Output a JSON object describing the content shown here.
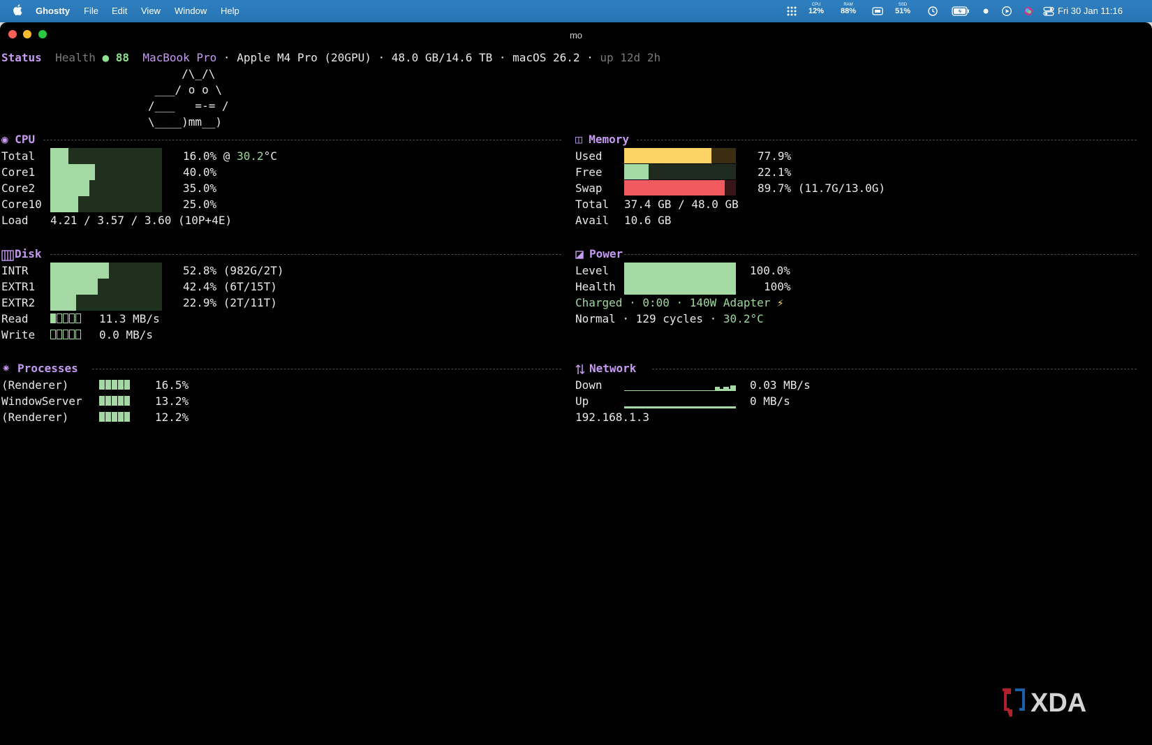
{
  "menubar": {
    "app": "Ghostty",
    "menus": [
      "File",
      "Edit",
      "View",
      "Window",
      "Help"
    ],
    "stats": [
      {
        "label": "CPU",
        "value": "12%"
      },
      {
        "label": "RAM",
        "value": "88%"
      },
      {
        "label": "SSD",
        "value": "51%"
      }
    ],
    "clock": "Fri 30 Jan 11:16"
  },
  "window": {
    "title": "mo"
  },
  "status": {
    "label": "Status",
    "health_label": "Health",
    "health_value": "88",
    "model": "MacBook Pro",
    "sep": " · ",
    "chip": "Apple M4 Pro (20GPU)",
    "storage": "48.0 GB/14.6 TB",
    "os": "macOS 26.2",
    "uptime": "up 12d 2h"
  },
  "ascii": [
    "     /\\_/\\",
    " ___/ o o \\",
    "/___   =-= /",
    "\\____)mm__)"
  ],
  "cpu": {
    "title": "◉ CPU",
    "rows": [
      {
        "label": "Total",
        "percent": 16.0,
        "text": "16.0% @ ",
        "temp": "30.2",
        "unit": "°C"
      },
      {
        "label": "Core1",
        "percent": 40.0,
        "text": "40.0%"
      },
      {
        "label": "Core2",
        "percent": 35.0,
        "text": "35.0%"
      },
      {
        "label": "Core10",
        "percent": 25.0,
        "text": "25.0%"
      }
    ],
    "load_label": "Load",
    "load_value": "4.21 / 3.57 / 3.60 (10P+4E)"
  },
  "memory": {
    "title": "◫ Memory",
    "rows": [
      {
        "label": "Used",
        "percent": 77.9,
        "text": "77.9%",
        "color": "#fdd265"
      },
      {
        "label": "Free",
        "percent": 22.1,
        "text": "22.1%",
        "color": "#a4d9a3"
      },
      {
        "label": "Swap",
        "percent": 89.7,
        "text": "89.7% (11.7G/13.0G)",
        "color": "#f15a5f"
      }
    ],
    "total_label": "Total",
    "total_value": "37.4 GB / 48.0 GB",
    "avail_label": "Avail",
    "avail_value": "10.6 GB"
  },
  "disk": {
    "title": "Disk",
    "rows": [
      {
        "label": "INTR",
        "percent": 52.8,
        "text": "52.8% (982G/2T)"
      },
      {
        "label": "EXTR1",
        "percent": 42.4,
        "text": "42.4% (6T/15T)"
      },
      {
        "label": "EXTR2",
        "percent": 22.9,
        "text": "22.9% (2T/11T)"
      }
    ],
    "read_label": "Read",
    "read_value": "11.3 MB/s",
    "write_label": "Write",
    "write_value": "0.0 MB/s"
  },
  "power": {
    "title": "Power",
    "level_label": "Level",
    "level_percent": 100.0,
    "level_text": "100.0%",
    "health_label": "Health",
    "health_text": "100%",
    "charge_line": "Charged · 0:00 · 140W Adapter",
    "charge_icon": "⚡",
    "normal_line": "Normal · 129 cycles · ",
    "temp": "30.2°C"
  },
  "processes": {
    "title": "Processes",
    "rows": [
      {
        "name": "(Renderer)",
        "percent": 16.5,
        "text": "16.5%"
      },
      {
        "name": "WindowServer",
        "percent": 13.2,
        "text": "13.2%"
      },
      {
        "name": "(Renderer)",
        "percent": 12.2,
        "text": "12.2%"
      }
    ]
  },
  "network": {
    "title": "Network",
    "down_label": "Down",
    "down_value": "0.03 MB/s",
    "up_label": "Up",
    "up_value": "0 MB/s",
    "ip": "192.168.1.3"
  },
  "watermark": "XDA"
}
